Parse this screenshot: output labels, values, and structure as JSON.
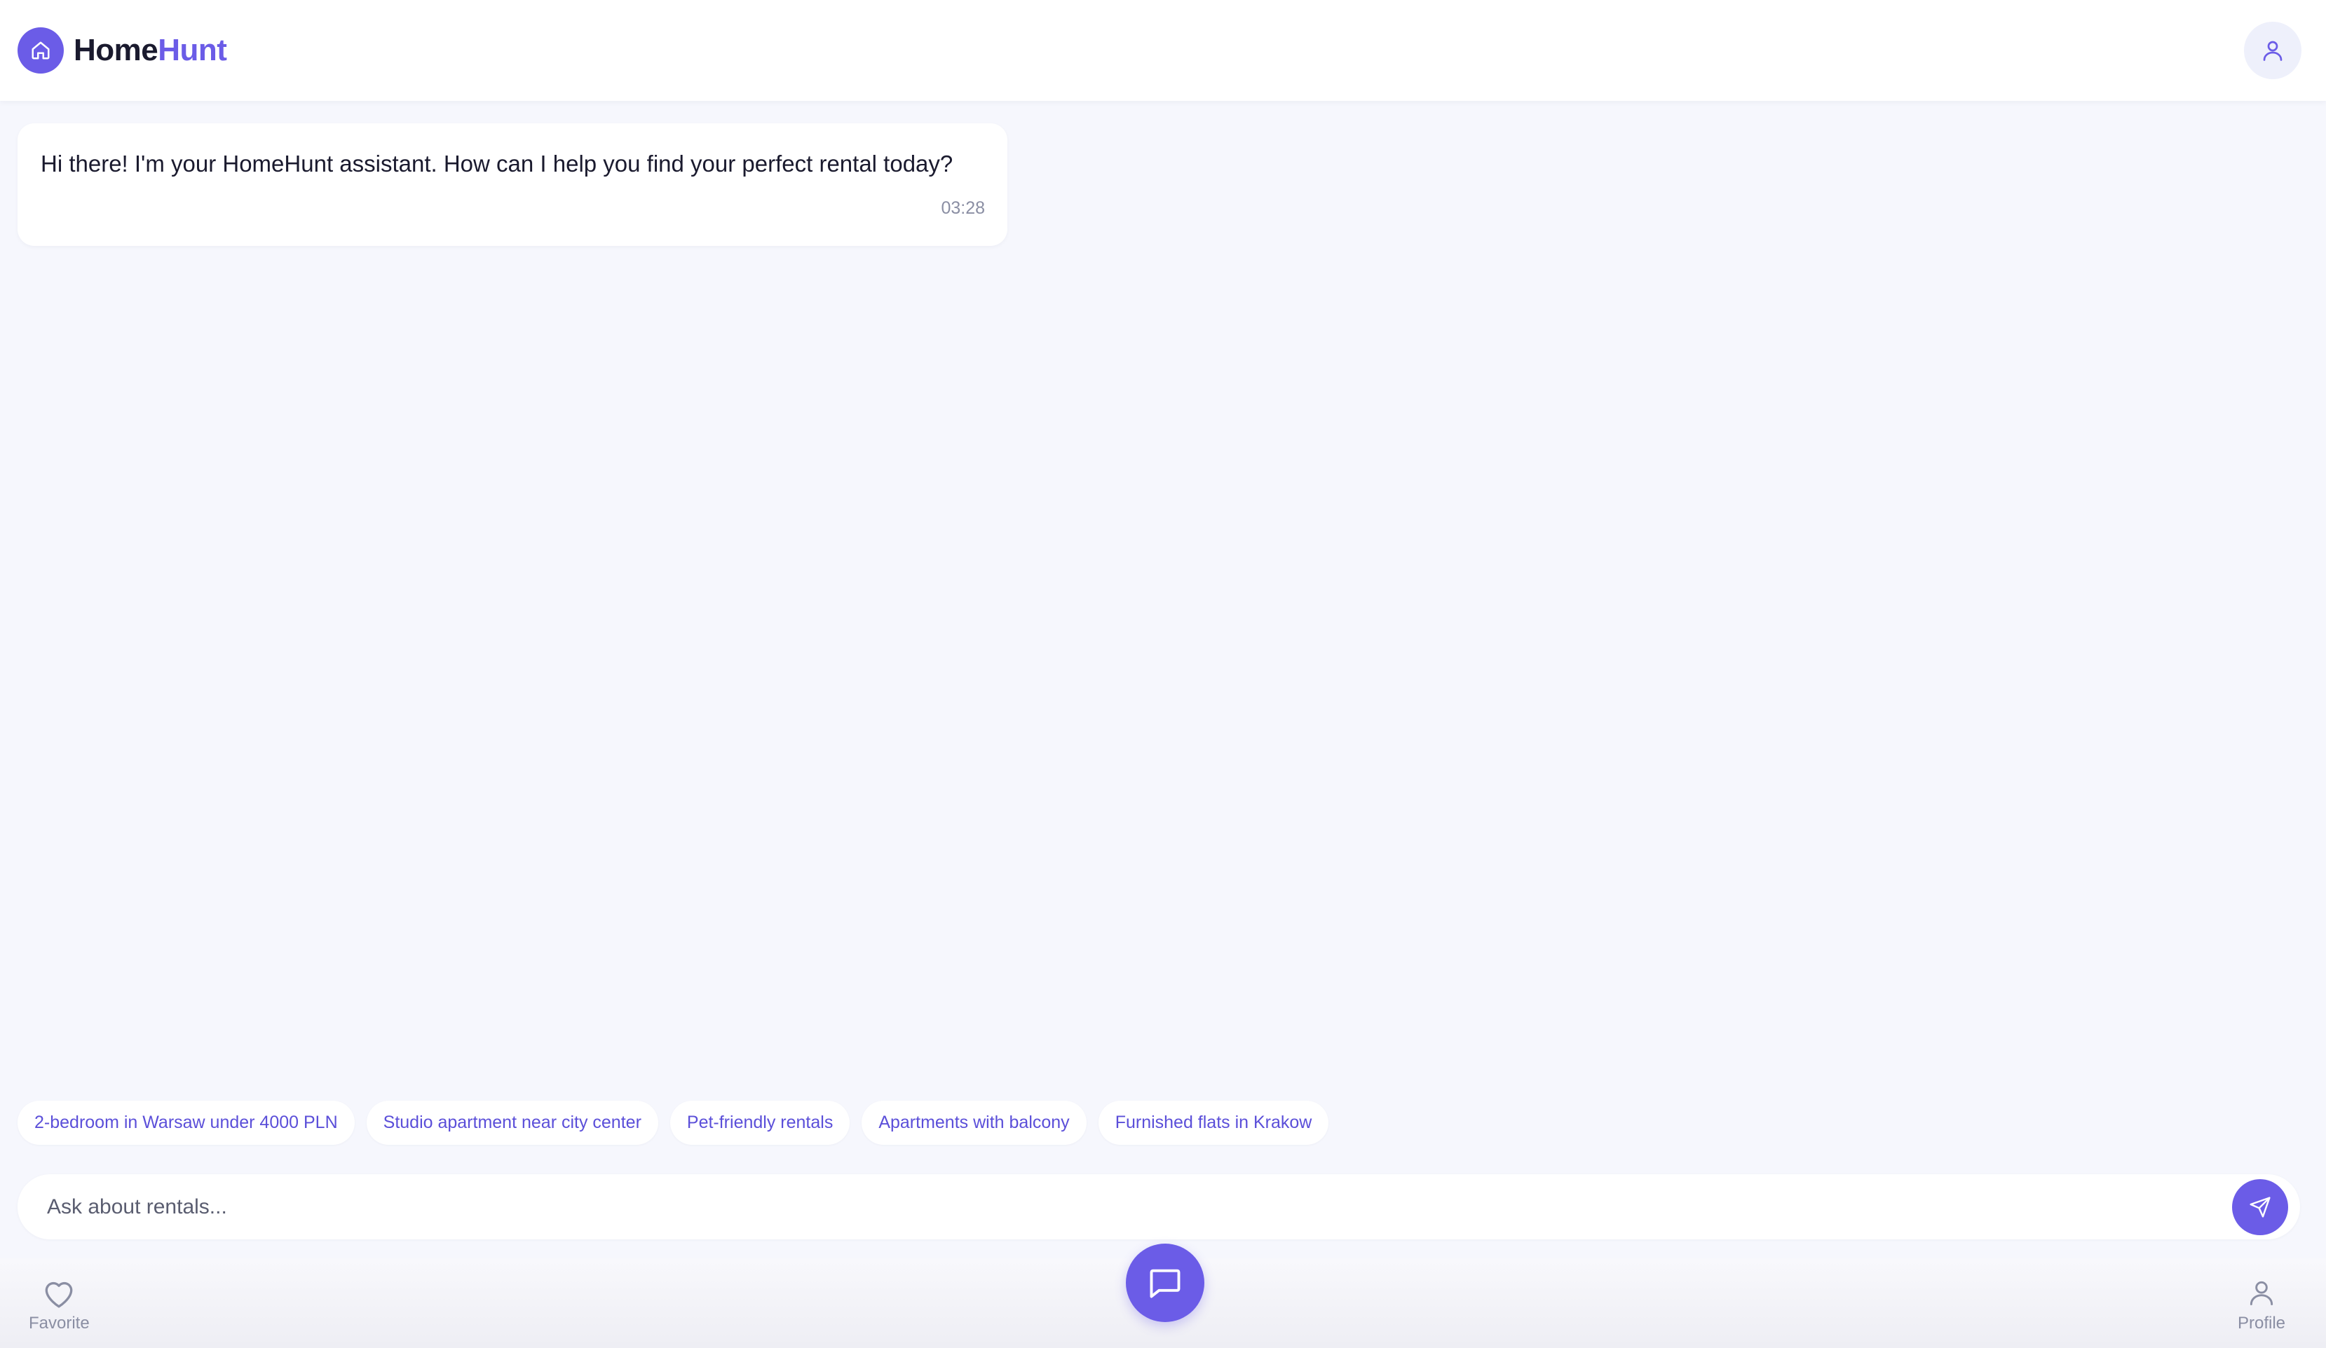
{
  "app": {
    "brand_part1": "Home",
    "brand_part2": "Hunt",
    "accent_color": "#6b5ce7"
  },
  "header": {
    "logo_icon": "home-icon",
    "profile_icon": "user-icon"
  },
  "chat": {
    "messages": [
      {
        "sender": "assistant",
        "text": "Hi there! I'm your HomeHunt assistant. How can I help you find your perfect rental today?",
        "time": "03:28"
      }
    ]
  },
  "suggestions": [
    "2-bedroom in Warsaw under 4000 PLN",
    "Studio apartment near city center",
    "Pet-friendly rentals",
    "Apartments with balcony",
    "Furnished flats in Krakow"
  ],
  "input": {
    "placeholder": "Ask about rentals...",
    "value": "",
    "send_icon": "send-icon"
  },
  "bottom_nav": {
    "favorite_label": "Favorite",
    "favorite_icon": "heart-icon",
    "chat_icon": "chat-bubble-icon",
    "profile_label": "Profile",
    "profile_icon": "user-icon"
  }
}
